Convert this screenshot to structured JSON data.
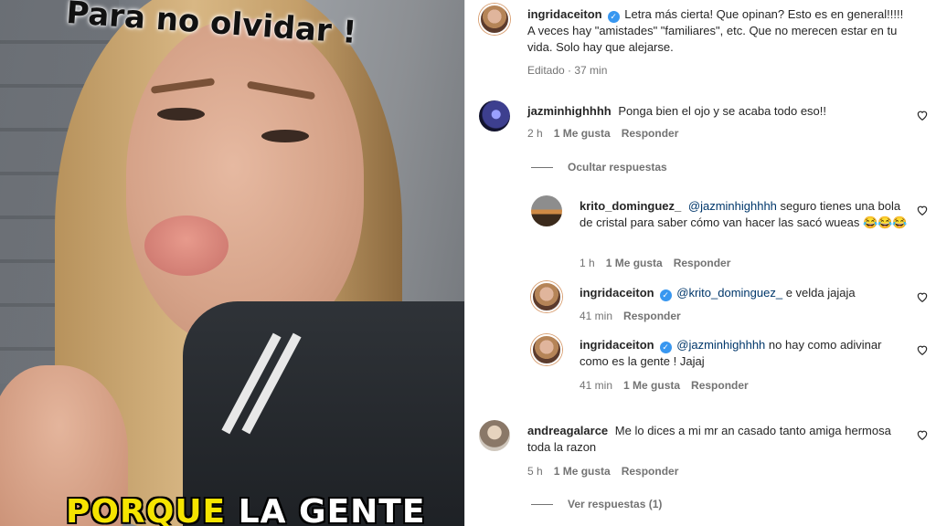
{
  "video": {
    "caption_top": "Para no olvidar !",
    "caption_bottom_highlight": "PORQUE",
    "caption_bottom_rest": "LA GENTE"
  },
  "post": {
    "username": "ingridaceiton",
    "text": "Letra más cierta! Que opinan? Esto es en general!!!!! A veces hay \"amistades\" \"familiares\", etc. Que no merecen estar en tu vida. Solo hay que alejarse.",
    "meta": "Editado · 37 min"
  },
  "comments": [
    {
      "username": "jazminhighhhh",
      "text": "Ponga bien el ojo y se acaba todo eso!!",
      "time": "2 h",
      "likes": "1 Me gusta",
      "reply": "Responder",
      "toggle": "Ocultar respuestas",
      "replies": [
        {
          "username": "krito_dominguez_",
          "mention": "@jazminhighhhh",
          "text": "seguro tienes una bola de cristal para saber cómo van hacer las sacó wueas 😂😂😂",
          "time": "1 h",
          "likes": "1 Me gusta",
          "reply": "Responder"
        },
        {
          "username": "ingridaceiton",
          "mention": "@krito_dominguez_",
          "text": "e velda jajaja",
          "time": "41 min",
          "reply": "Responder"
        },
        {
          "username": "ingridaceiton",
          "mention": "@jazminhighhhh",
          "text": "no hay como adivinar como es la gente ! Jajaj",
          "time": "41 min",
          "likes": "1 Me gusta",
          "reply": "Responder"
        }
      ]
    },
    {
      "username": "andreagalarce",
      "text": "Me lo dices a mi mr an casado tanto amiga hermosa toda la razon",
      "time": "5 h",
      "likes": "1 Me gusta",
      "reply": "Responder",
      "toggle": "Ver respuestas (1)"
    }
  ]
}
